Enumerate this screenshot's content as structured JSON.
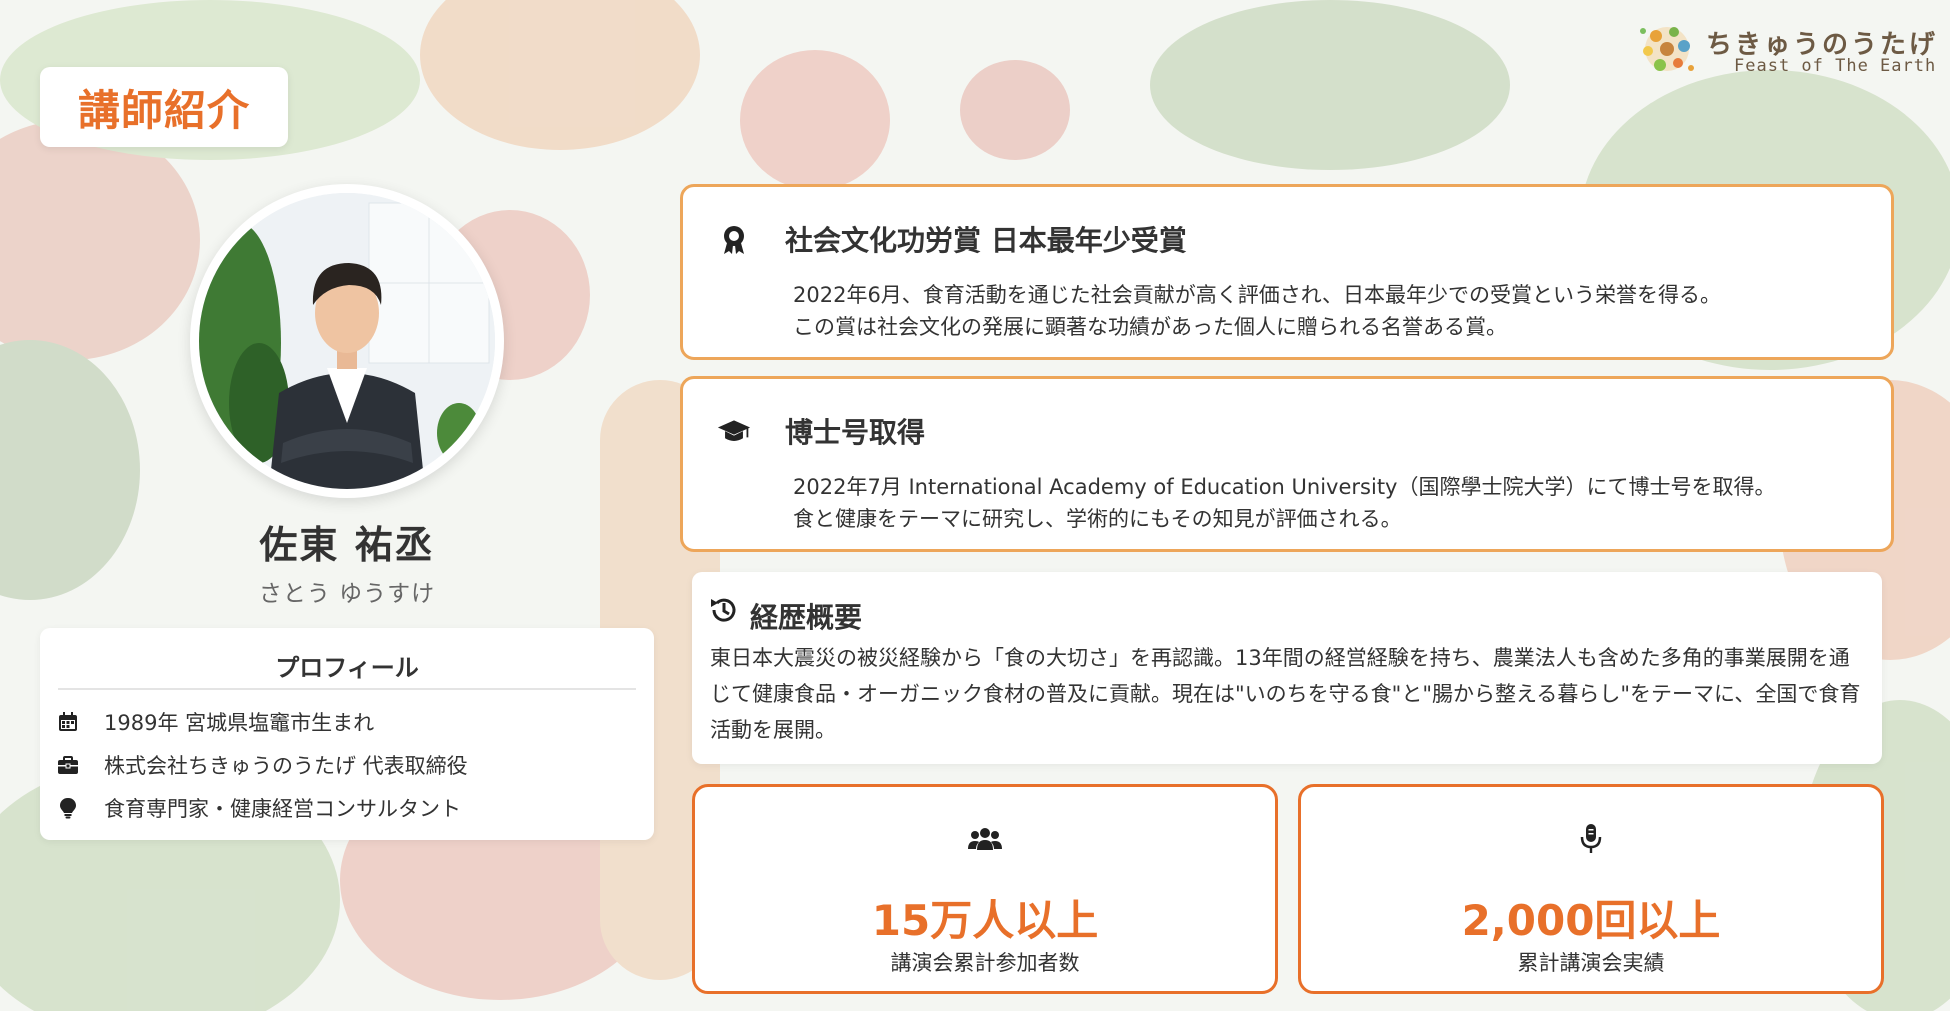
{
  "page_title": "講師紹介",
  "brand": {
    "name": "ちきゅうのうたげ",
    "subtitle": "Feast of The Earth"
  },
  "instructor": {
    "name": "佐東 祐丞",
    "kana": "さとう ゆうすけ"
  },
  "profile": {
    "heading": "プロフィール",
    "items": [
      {
        "icon": "calendar-icon",
        "text": "1989年 宮城県塩竈市生まれ"
      },
      {
        "icon": "briefcase-icon",
        "text": "株式会社ちきゅうのうたげ 代表取締役"
      },
      {
        "icon": "lightbulb-icon",
        "text": "食育専門家・健康経営コンサルタント"
      }
    ]
  },
  "achievements": [
    {
      "icon": "award-icon",
      "title": "社会文化功労賞 日本最年少受賞",
      "line1": "2022年6月、食育活動を通じた社会貢献が高く評価され、日本最年少での受賞という栄誉を得る。",
      "line2": "この賞は社会文化の発展に顕著な功績があった個人に贈られる名誉ある賞。"
    },
    {
      "icon": "graduation-cap-icon",
      "title": "博士号取得",
      "line1": "2022年7月 International Academy of Education University（国際學士院大学）にて博士号を取得。",
      "line2": "食と健康をテーマに研究し、学術的にもその知見が評価される。"
    }
  ],
  "career": {
    "icon": "history-icon",
    "heading": "経歴概要",
    "text": "東日本大震災の被災経験から「食の大切さ」を再認識。13年間の経営経験を持ち、農業法人も含めた多角的事業展開を通じて健康食品・オーガニック食材の普及に貢献。現在は\"いのちを守る食\"と\"腸から整える暮らし\"をテーマに、全国で食育活動を展開。"
  },
  "stats": [
    {
      "icon": "users-icon",
      "value": "15万人以上",
      "label": "講演会累計参加者数"
    },
    {
      "icon": "microphone-icon",
      "value": "2,000回以上",
      "label": "累計講演会実績"
    }
  ],
  "colors": {
    "accent": "#e8702a",
    "card_border": "#eda65a",
    "text": "#333333"
  }
}
